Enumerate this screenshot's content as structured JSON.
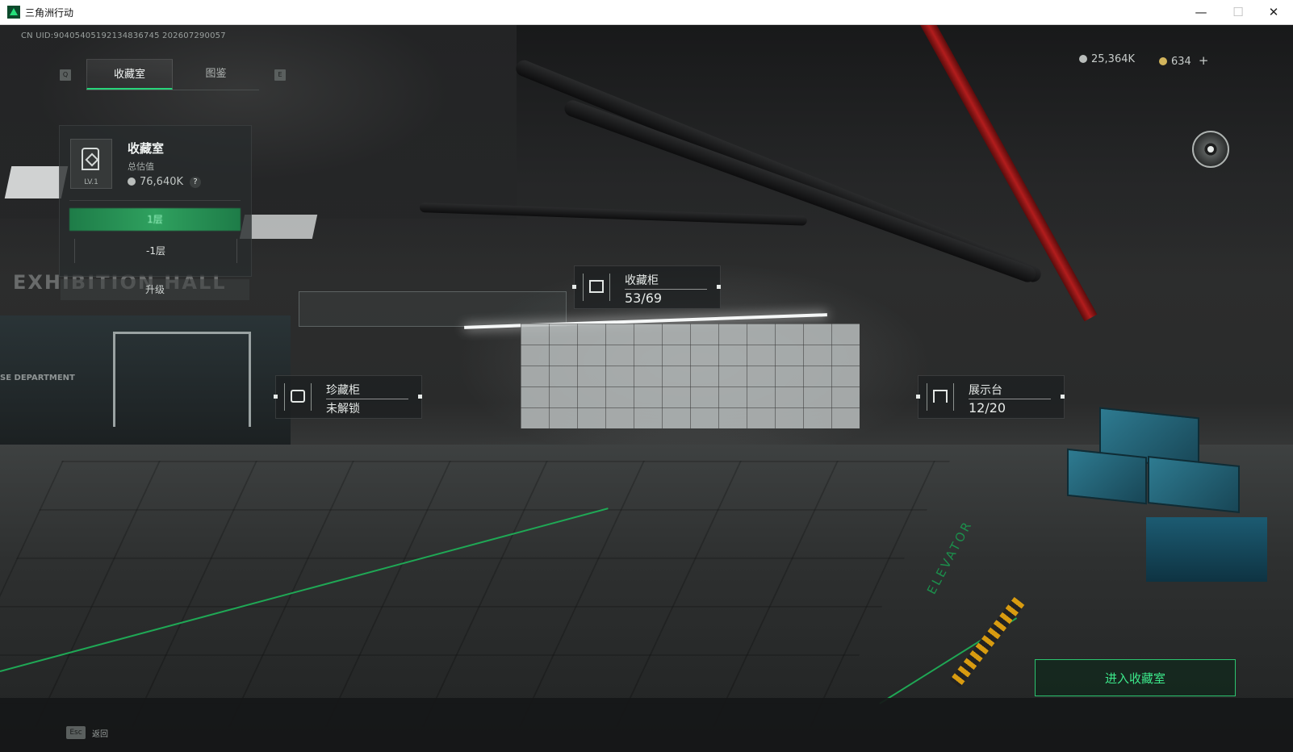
{
  "window": {
    "title": "三角洲行动",
    "min_glyph": "—",
    "max_glyph": "☐",
    "close_glyph": "✕"
  },
  "hud": {
    "uid": "CN UID:9040540519213483674​5 202607290057",
    "tab_prev_key": "Q",
    "tab_next_key": "E",
    "tabs": [
      {
        "label": "收藏室",
        "active": true
      },
      {
        "label": "图鉴",
        "active": false
      }
    ],
    "currency": [
      {
        "icon": "silver-coin-icon",
        "value": "25,364K"
      },
      {
        "icon": "gold-coin-icon",
        "value": "634",
        "action": "+"
      }
    ]
  },
  "room_panel": {
    "title": "收藏室",
    "level": "LV.1",
    "estimate_label": "总估值",
    "estimate_value": "76,640K",
    "help_glyph": "?",
    "floors": [
      {
        "label": "1层",
        "active": true
      },
      {
        "label": "-1层",
        "active": false
      }
    ],
    "upgrade_label": "升级"
  },
  "callouts": [
    {
      "id": "cabinet",
      "name": "收藏柜",
      "value": "53/69",
      "icon": "cabinet-icon"
    },
    {
      "id": "treasure",
      "name": "珍藏柜",
      "value": "未解锁",
      "icon": "treasure-cabinet-icon"
    },
    {
      "id": "display",
      "name": "展示台",
      "value": "12/20",
      "icon": "display-stand-icon"
    }
  ],
  "scene_text": {
    "exhibition": "EXHIBITION HALL",
    "department": "SE    DEPARTMENT",
    "elevator": "ELEVATOR"
  },
  "actions": {
    "enter_label": "进入收藏室",
    "back_key": "Esc",
    "back_label": "返回"
  },
  "colors": {
    "accent_green": "#27d47a",
    "panel_bg": "#2a2e2f",
    "pipe_red": "#b21d1d"
  }
}
